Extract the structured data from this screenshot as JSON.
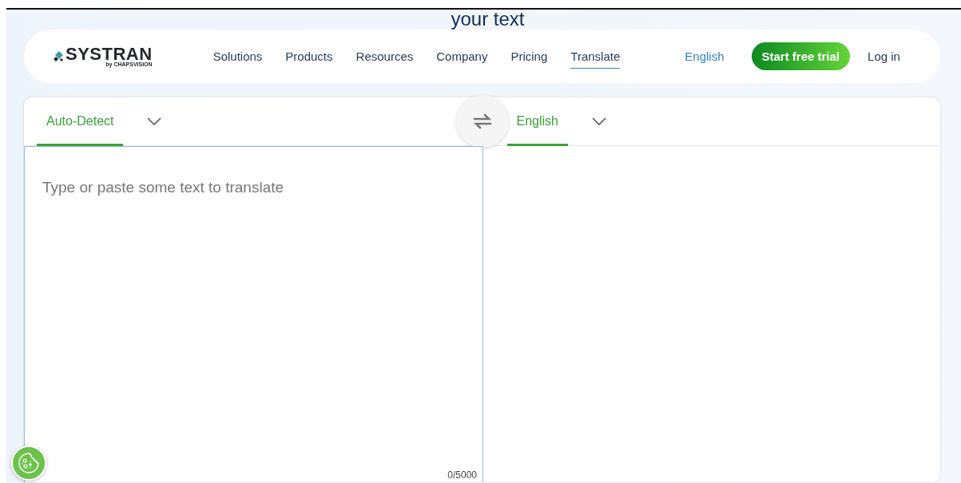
{
  "headline": "your text",
  "nav": {
    "logo": "SYSTRAN",
    "logo_sub": "by CHAPSVISION",
    "items": [
      {
        "label": "Solutions",
        "selected": false
      },
      {
        "label": "Products",
        "selected": false
      },
      {
        "label": "Resources",
        "selected": false
      },
      {
        "label": "Company",
        "selected": false
      },
      {
        "label": "Pricing",
        "selected": false
      },
      {
        "label": "Translate",
        "selected": true
      }
    ],
    "language": "English",
    "cta": "Start free trial",
    "login": "Log in"
  },
  "translator": {
    "source": {
      "label": "Auto-Detect",
      "selected": true
    },
    "target": {
      "label": "English",
      "selected": true
    },
    "input": {
      "placeholder": "Type or paste some text to translate"
    },
    "counter": "0/5000"
  }
}
